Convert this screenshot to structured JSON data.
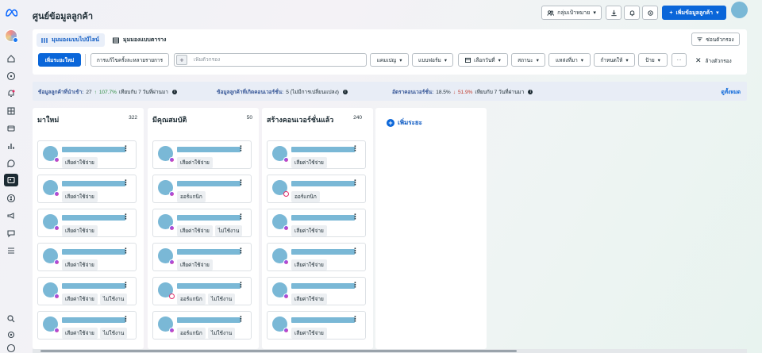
{
  "header": {
    "title": "ศูนย์ข้อมูลลูกค้า",
    "audience_label": "กลุ่มเป้าหมาย",
    "add_customer_label": "เพิ่มข้อมูลลูกค้า"
  },
  "view_tabs": [
    {
      "label": "มุมมองแบบไปป์ไลน์",
      "active": true
    },
    {
      "label": "มุมมองแบบตาราง",
      "active": false
    }
  ],
  "toolbar": {
    "hide_filter_label": "ซ่อนตัวกรอง",
    "add_new_label": "เพิ่มระยะใหม่",
    "bulk_edit_label": "การแก้ไขครั้งละหลายรายการ",
    "search_placeholder": "เพิ่มตัวกรอง",
    "clear_filters_label": "ล้างตัวกรอง",
    "filters": [
      "แคมเปญ",
      "แบบฟอร์ม",
      "เลือกวันที่",
      "สถานะ",
      "แหล่งที่มา",
      "กำหนดให้",
      "ป้าย"
    ]
  },
  "stats": {
    "new_customers": {
      "label": "ข้อมูลลูกค้าที่นำเข้า:",
      "value": "27",
      "change": "107.7%",
      "suffix": "เทียบกับ 7 วันที่ผ่านมา"
    },
    "converted": {
      "label": "ข้อมูลลูกค้าที่เกิดคอนเวอร์ชั่น:",
      "value": "5 (ไม่มีการเปลี่ยนแปลง)"
    },
    "conversion_rate": {
      "label": "อัตราคอนเวอร์ชั่น:",
      "value": "18.5%",
      "change": "51.9%",
      "suffix": "เทียบกับ 7 วันที่ผ่านมา"
    },
    "see_all_label": "ดูทั้งหมด"
  },
  "columns": [
    {
      "title": "มาใหม่",
      "count": "322",
      "cards": [
        {
          "tags": [
            "เสียค่าใช้จ่าย"
          ],
          "channel": "messenger"
        },
        {
          "tags": [
            "เสียค่าใช้จ่าย"
          ],
          "channel": "messenger"
        },
        {
          "tags": [
            "เสียค่าใช้จ่าย"
          ],
          "channel": "messenger"
        },
        {
          "tags": [
            "เสียค่าใช้จ่าย"
          ],
          "channel": "messenger"
        },
        {
          "tags": [
            "เสียค่าใช้จ่าย",
            "ไม่ใช้งาน"
          ],
          "channel": "messenger"
        },
        {
          "tags": [
            "เสียค่าใช้จ่าย",
            "ไม่ใช้งาน"
          ],
          "channel": "messenger"
        }
      ]
    },
    {
      "title": "มีคุณสมบัติ",
      "count": "50",
      "cards": [
        {
          "tags": [
            "เสียค่าใช้จ่าย"
          ],
          "channel": "messenger"
        },
        {
          "tags": [
            "ออร์แกนิก"
          ],
          "channel": "messenger"
        },
        {
          "tags": [
            "เสียค่าใช้จ่าย",
            "ไม่ใช้งาน"
          ],
          "channel": "messenger"
        },
        {
          "tags": [
            "เสียค่าใช้จ่าย"
          ],
          "channel": "messenger"
        },
        {
          "tags": [
            "ออร์แกนิก",
            "ไม่ใช้งาน"
          ],
          "channel": "instagram"
        },
        {
          "tags": [
            "ออร์แกนิก",
            "ไม่ใช้งาน"
          ],
          "channel": "messenger"
        }
      ]
    },
    {
      "title": "สร้างคอนเวอร์ชั่นแล้ว",
      "count": "240",
      "cards": [
        {
          "tags": [
            "เสียค่าใช้จ่าย"
          ],
          "channel": "messenger"
        },
        {
          "tags": [
            "ออร์แกนิก"
          ],
          "channel": "instagram"
        },
        {
          "tags": [
            "เสียค่าใช้จ่าย"
          ],
          "channel": "messenger"
        },
        {
          "tags": [
            "เสียค่าใช้จ่าย"
          ],
          "channel": "messenger"
        },
        {
          "tags": [
            "เสียค่าใช้จ่าย"
          ],
          "channel": "messenger"
        },
        {
          "tags": [
            "เสียค่าใช้จ่าย"
          ],
          "channel": "messenger"
        }
      ]
    }
  ],
  "add_stage_label": "เพิ่มระยะ",
  "colors": {
    "accent": "#0a66d9",
    "placeholder_blur": "#7ab8d6",
    "stats_bg": "#e8edf6"
  }
}
